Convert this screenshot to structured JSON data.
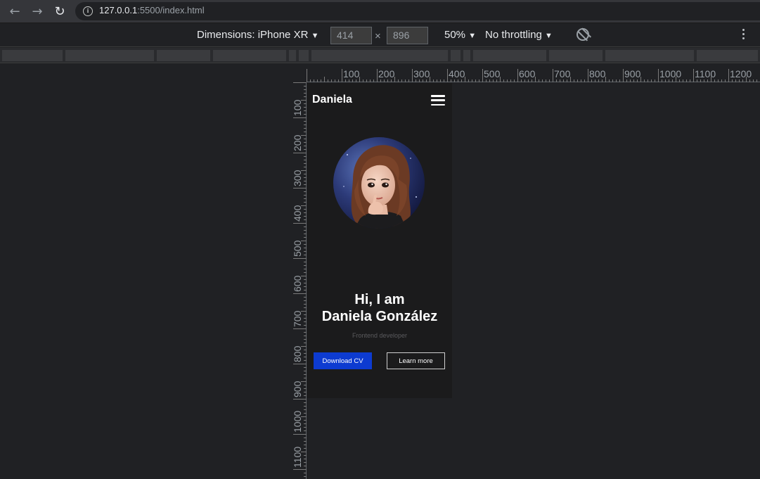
{
  "browser": {
    "url_host": "127.0.0.1",
    "url_path": ":5500/index.html",
    "back_icon": "arrow-left-icon",
    "forward_icon": "arrow-right-icon",
    "reload_icon": "reload-icon"
  },
  "device_toolbar": {
    "dimensions_label": "Dimensions: iPhone XR",
    "width": "414",
    "height": "896",
    "times": "×",
    "zoom": "50%",
    "throttling": "No throttling",
    "dropdown_arrow": "▼",
    "rotate_icon": "rotate-icon",
    "more_icon": "kebab-menu-icon"
  },
  "rulers": {
    "top_labels": [
      "100",
      "200",
      "300",
      "400",
      "500",
      "600",
      "700",
      "800",
      "900",
      "1000",
      "1100",
      "1200"
    ],
    "left_labels": [
      "100",
      "200",
      "300",
      "400",
      "500",
      "600",
      "700",
      "800",
      "900",
      "1000",
      "1100"
    ]
  },
  "page": {
    "logo": "Daniela",
    "menu_icon": "hamburger-menu-icon",
    "avatar_icon": "avatar-icon",
    "hero_line1": "Hi, I am",
    "hero_line2": "Daniela González",
    "subtitle": "Frontend developer",
    "download_button": "Download CV",
    "learn_more_button": "Learn more"
  },
  "colors": {
    "page_bg": "#1b1b1c",
    "primary_button": "#0d3bd1",
    "devtools_bg": "#202124"
  }
}
